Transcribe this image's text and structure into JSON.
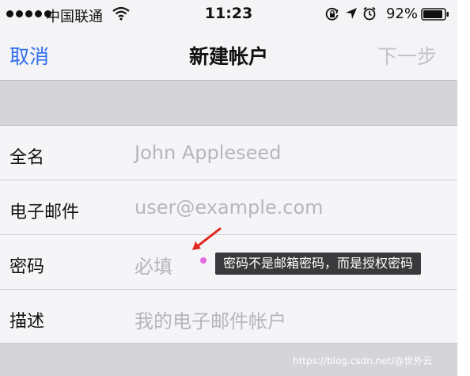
{
  "status_bar": {
    "carrier": "中国联通",
    "time": "11:23",
    "battery": "92%"
  },
  "nav": {
    "cancel": "取消",
    "title": "新建帐户",
    "next": "下一步"
  },
  "form": {
    "rows": [
      {
        "label": "全名",
        "placeholder": "John Appleseed"
      },
      {
        "label": "电子邮件",
        "placeholder": "user@example.com"
      },
      {
        "label": "密码",
        "placeholder": "必填"
      },
      {
        "label": "描述",
        "placeholder": "我的电子邮件帐户"
      }
    ]
  },
  "annotation": {
    "text": "密码不是邮箱密码，而是授权密码",
    "arrow_color": "#e0281e"
  },
  "watermark": "https://blog.csdn.net/@世外云",
  "colors": {
    "accent": "#2f6ff0",
    "disabled": "#c4c4c8",
    "placeholder": "#b6b6bb"
  }
}
